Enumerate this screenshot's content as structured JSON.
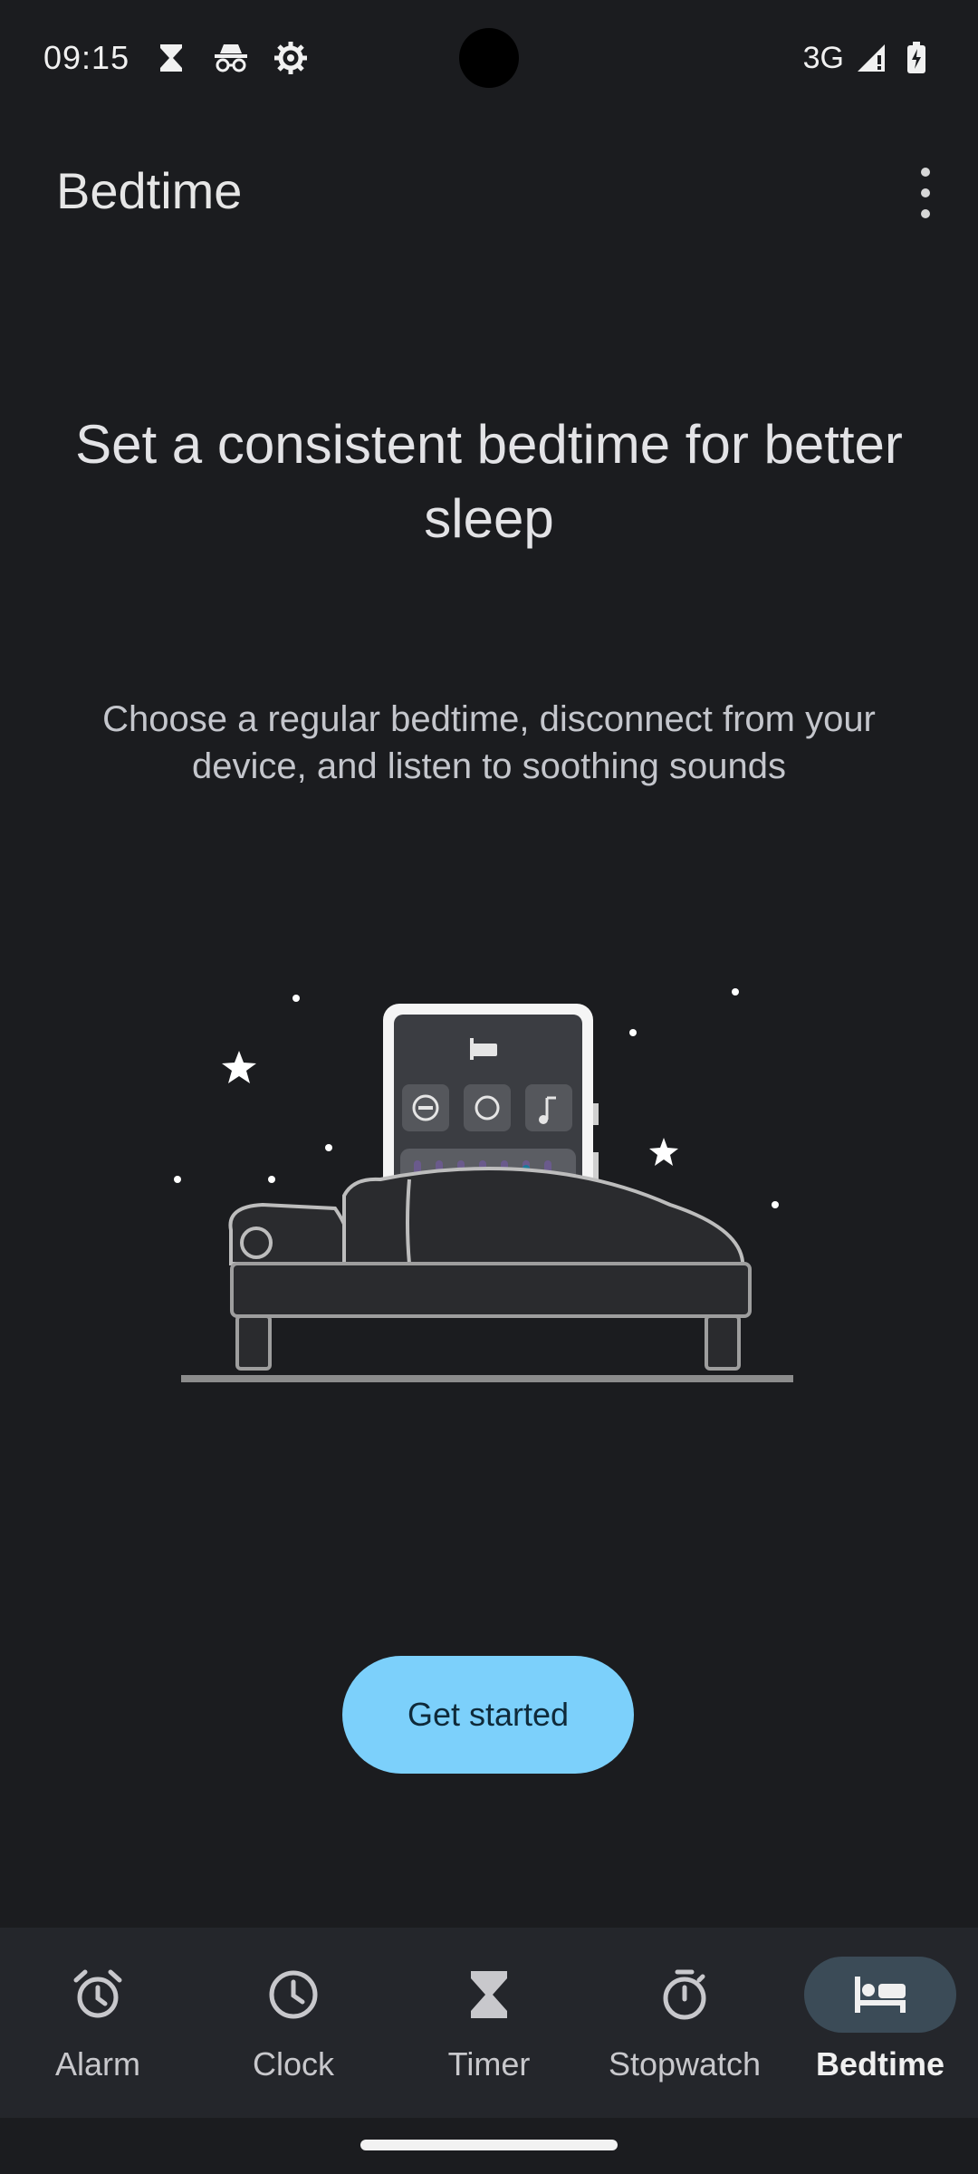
{
  "status_bar": {
    "time": "09:15",
    "network": "3G",
    "icons": [
      "hourglass-icon",
      "incognito-icon",
      "settings-gear-icon",
      "signal-icon",
      "battery-charging-icon"
    ]
  },
  "app_bar": {
    "title": "Bedtime",
    "overflow_icon": "more-vert-icon"
  },
  "main": {
    "headline": "Set a consistent bedtime for better sleep",
    "subhead": "Choose a regular bedtime, disconnect from your device, and listen to soothing sounds",
    "illustration_icon": "sleeping-person-phone-illustration",
    "primary_button_label": "Get started"
  },
  "bottom_nav": {
    "items": [
      {
        "label": "Alarm",
        "icon": "alarm-icon",
        "active": false
      },
      {
        "label": "Clock",
        "icon": "clock-icon",
        "active": false
      },
      {
        "label": "Timer",
        "icon": "hourglass-icon",
        "active": false
      },
      {
        "label": "Stopwatch",
        "icon": "stopwatch-icon",
        "active": false
      },
      {
        "label": "Bedtime",
        "icon": "bed-icon",
        "active": true
      }
    ]
  },
  "colors": {
    "background": "#1b1c1f",
    "accent_button": "#7cd0fb",
    "nav_background": "#24262b",
    "nav_active_pill": "#3b4b57"
  }
}
